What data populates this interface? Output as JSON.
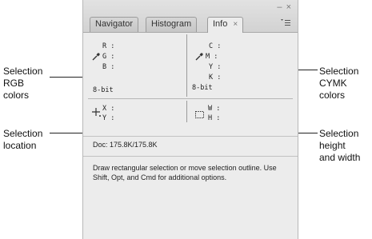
{
  "tabs": [
    {
      "label": "Navigator"
    },
    {
      "label": "Histogram"
    },
    {
      "label": "Info"
    }
  ],
  "window_controls": {
    "minimize": "–",
    "close": "×"
  },
  "icons": {
    "eyedropper_left": "eyedropper-icon",
    "eyedropper_right": "eyedropper-icon",
    "crosshair": "crosshair-icon",
    "marquee": "selection-marquee-icon",
    "panel_menu": "panel-menu-icon",
    "tab_close": "close-icon"
  },
  "info": {
    "rgb": {
      "r": "R :",
      "g": "G :",
      "b": "B :",
      "depth": "8-bit"
    },
    "cmyk": {
      "c": "C :",
      "m": "M :",
      "y": "Y :",
      "k": "K :",
      "depth": "8-bit"
    },
    "xy": {
      "x": "X :",
      "y": "Y :"
    },
    "wh": {
      "w": "W :",
      "h": "H :"
    },
    "doc": "Doc: 175.8K/175.8K",
    "description": "Draw rectangular selection or move selection outline.  Use Shift, Opt, and Cmd for additional options."
  },
  "callouts": {
    "rgb": [
      "Selection",
      "RGB",
      "colors"
    ],
    "cmyk": [
      "Selection",
      "CYMK",
      "colors"
    ],
    "location": [
      "Selection",
      "location"
    ],
    "size": [
      "Selection",
      "height",
      "and width"
    ]
  }
}
